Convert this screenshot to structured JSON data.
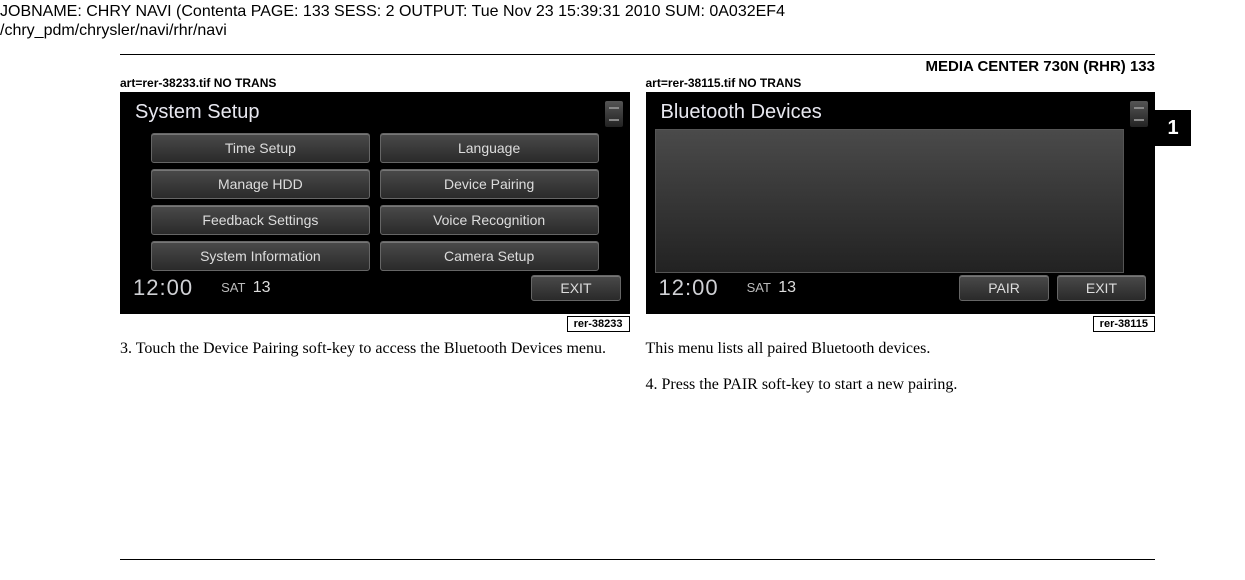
{
  "job_header_line1": "JOBNAME: CHRY NAVI (Contenta    PAGE: 133   SESS: 2   OUTPUT: Tue Nov 23 15:39:31 2010   SUM: 0A032EF4",
  "job_header_line2": "/chry_pdm/chrysler/navi/rhr/navi",
  "header_right": "MEDIA CENTER 730N (RHR)   133",
  "side_tab": "1",
  "left": {
    "art_label": "art=rer-38233.tif       NO TRANS",
    "screen_title": "System Setup",
    "buttons": [
      "Time Setup",
      "Language",
      "Manage HDD",
      "Device Pairing",
      "Feedback Settings",
      "Voice Recognition",
      "System Information",
      "Camera Setup"
    ],
    "clock": "12:00",
    "date_day": "SAT",
    "date_num": "13",
    "exit": "EXIT",
    "rer_tag": "rer-38233",
    "caption": "3. Touch the Device Pairing soft-key to access the Bluetooth Devices menu."
  },
  "right": {
    "art_label": "art=rer-38115.tif       NO TRANS",
    "screen_title": "Bluetooth Devices",
    "clock": "12:00",
    "date_day": "SAT",
    "date_num": "13",
    "pair": "PAIR",
    "exit": "EXIT",
    "rer_tag": "rer-38115",
    "caption1": "This menu lists all paired Bluetooth devices.",
    "caption2": "4.  Press the PAIR soft-key to start a new pairing."
  }
}
